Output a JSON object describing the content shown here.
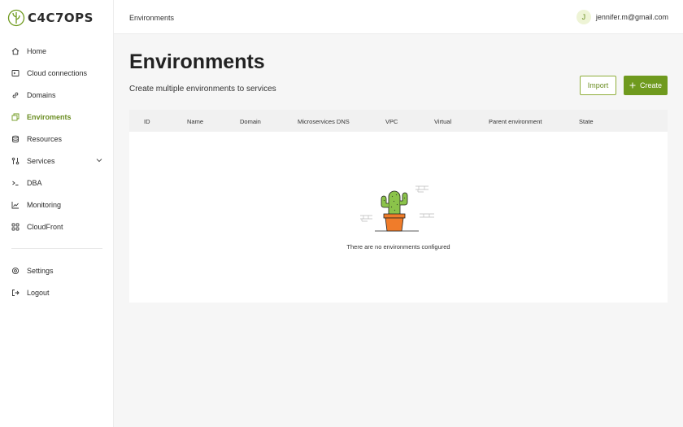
{
  "brand": {
    "name": "C4C7OPS",
    "accent": "#6f9a1e"
  },
  "sidebar": {
    "items": [
      {
        "label": "Home",
        "icon": "home-icon"
      },
      {
        "label": "Cloud connections",
        "icon": "cloud-connection-icon"
      },
      {
        "label": "Domains",
        "icon": "link-icon"
      },
      {
        "label": "Enviroments",
        "icon": "layers-icon",
        "active": true
      },
      {
        "label": "Resources",
        "icon": "database-icon"
      },
      {
        "label": "Services",
        "icon": "services-icon",
        "expandable": true
      },
      {
        "label": "DBA",
        "icon": "terminal-icon"
      },
      {
        "label": "Monitoring",
        "icon": "chart-icon"
      },
      {
        "label": "CloudFront",
        "icon": "grid-icon"
      }
    ],
    "bottom": [
      {
        "label": "Settings",
        "icon": "gear-icon"
      },
      {
        "label": "Logout",
        "icon": "logout-icon"
      }
    ]
  },
  "topbar": {
    "breadcrumb": "Environments",
    "user": {
      "initial": "J",
      "email": "jennifer.m@gmail.com"
    }
  },
  "main": {
    "title": "Environments",
    "subtitle": "Create multiple environments to services",
    "import_label": "Import",
    "create_label": "Create",
    "table": {
      "columns": [
        "ID",
        "Name",
        "Domain",
        "Microservices DNS",
        "VPC",
        "Virtual",
        "Parent environment",
        "State"
      ],
      "empty_text": "There are no environments configured"
    }
  }
}
